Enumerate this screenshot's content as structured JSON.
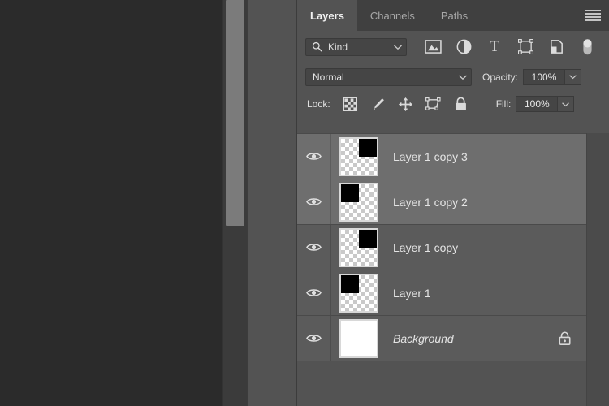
{
  "app": {
    "panel_title": "Layers"
  },
  "tabs": [
    {
      "label": "Layers",
      "active": true
    },
    {
      "label": "Channels",
      "active": false
    },
    {
      "label": "Paths",
      "active": false
    }
  ],
  "panel_menu": {
    "icon": "hamburger-menu-icon"
  },
  "filter": {
    "search_icon": "search-icon",
    "kind_label": "Kind",
    "chevron": "chevron-down-icon",
    "type_icons": [
      {
        "name": "filter-pixel-layers-icon",
        "glyph": "image"
      },
      {
        "name": "filter-adjustment-layers-icon",
        "glyph": "half-circle"
      },
      {
        "name": "filter-type-layers-icon",
        "glyph": "T"
      },
      {
        "name": "filter-shape-layers-icon",
        "glyph": "shape"
      },
      {
        "name": "filter-smart-object-icon",
        "glyph": "smart-object"
      }
    ],
    "toggle_name": "filter-enable-toggle"
  },
  "blend": {
    "mode": "Normal",
    "mode_chevron": "chevron-down-icon",
    "opacity_label": "Opacity:",
    "opacity_value": "100%",
    "opacity_chevron": "chevron-down-icon"
  },
  "lock": {
    "label": "Lock:",
    "icons": [
      {
        "name": "lock-transparent-pixels-icon"
      },
      {
        "name": "lock-image-pixels-icon"
      },
      {
        "name": "lock-position-icon"
      },
      {
        "name": "lock-artboard-nesting-icon"
      },
      {
        "name": "lock-all-icon"
      }
    ],
    "fill_label": "Fill:",
    "fill_value": "100%",
    "fill_chevron": "chevron-down-icon"
  },
  "layers": [
    {
      "name": "Layer 1 copy 3",
      "visible": true,
      "selected": true,
      "italic": false,
      "locked": false,
      "thumb": {
        "type": "transparent",
        "block": "top-right"
      }
    },
    {
      "name": "Layer 1 copy 2",
      "visible": true,
      "selected": true,
      "italic": false,
      "locked": false,
      "thumb": {
        "type": "transparent",
        "block": "top-left"
      }
    },
    {
      "name": "Layer 1 copy",
      "visible": true,
      "selected": false,
      "italic": false,
      "locked": false,
      "thumb": {
        "type": "transparent",
        "block": "top-right"
      }
    },
    {
      "name": "Layer 1",
      "visible": true,
      "selected": false,
      "italic": false,
      "locked": false,
      "thumb": {
        "type": "transparent",
        "block": "top-left"
      }
    },
    {
      "name": "Background",
      "visible": true,
      "selected": false,
      "italic": true,
      "locked": true,
      "thumb": {
        "type": "solid-white",
        "block": "none"
      }
    }
  ],
  "colors": {
    "panel_bg": "#535353",
    "tabbar_bg": "#404040",
    "row_bg": "#5b5b5b",
    "row_selected_bg": "#6e6e6e",
    "canvas_bg": "#2b2b2b",
    "scrollbar_thumb": "#7b7b7b",
    "text": "#e4e4e4"
  }
}
